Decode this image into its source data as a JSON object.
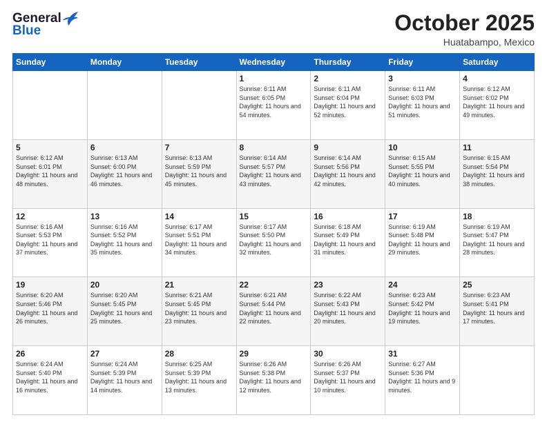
{
  "header": {
    "logo_general": "General",
    "logo_blue": "Blue",
    "month": "October 2025",
    "location": "Huatabampo, Mexico"
  },
  "weekdays": [
    "Sunday",
    "Monday",
    "Tuesday",
    "Wednesday",
    "Thursday",
    "Friday",
    "Saturday"
  ],
  "weeks": [
    [
      {
        "day": "",
        "sunrise": "",
        "sunset": "",
        "daylight": ""
      },
      {
        "day": "",
        "sunrise": "",
        "sunset": "",
        "daylight": ""
      },
      {
        "day": "",
        "sunrise": "",
        "sunset": "",
        "daylight": ""
      },
      {
        "day": "1",
        "sunrise": "Sunrise: 6:11 AM",
        "sunset": "Sunset: 6:05 PM",
        "daylight": "Daylight: 11 hours and 54 minutes."
      },
      {
        "day": "2",
        "sunrise": "Sunrise: 6:11 AM",
        "sunset": "Sunset: 6:04 PM",
        "daylight": "Daylight: 11 hours and 52 minutes."
      },
      {
        "day": "3",
        "sunrise": "Sunrise: 6:11 AM",
        "sunset": "Sunset: 6:03 PM",
        "daylight": "Daylight: 11 hours and 51 minutes."
      },
      {
        "day": "4",
        "sunrise": "Sunrise: 6:12 AM",
        "sunset": "Sunset: 6:02 PM",
        "daylight": "Daylight: 11 hours and 49 minutes."
      }
    ],
    [
      {
        "day": "5",
        "sunrise": "Sunrise: 6:12 AM",
        "sunset": "Sunset: 6:01 PM",
        "daylight": "Daylight: 11 hours and 48 minutes."
      },
      {
        "day": "6",
        "sunrise": "Sunrise: 6:13 AM",
        "sunset": "Sunset: 6:00 PM",
        "daylight": "Daylight: 11 hours and 46 minutes."
      },
      {
        "day": "7",
        "sunrise": "Sunrise: 6:13 AM",
        "sunset": "Sunset: 5:59 PM",
        "daylight": "Daylight: 11 hours and 45 minutes."
      },
      {
        "day": "8",
        "sunrise": "Sunrise: 6:14 AM",
        "sunset": "Sunset: 5:57 PM",
        "daylight": "Daylight: 11 hours and 43 minutes."
      },
      {
        "day": "9",
        "sunrise": "Sunrise: 6:14 AM",
        "sunset": "Sunset: 5:56 PM",
        "daylight": "Daylight: 11 hours and 42 minutes."
      },
      {
        "day": "10",
        "sunrise": "Sunrise: 6:15 AM",
        "sunset": "Sunset: 5:55 PM",
        "daylight": "Daylight: 11 hours and 40 minutes."
      },
      {
        "day": "11",
        "sunrise": "Sunrise: 6:15 AM",
        "sunset": "Sunset: 5:54 PM",
        "daylight": "Daylight: 11 hours and 38 minutes."
      }
    ],
    [
      {
        "day": "12",
        "sunrise": "Sunrise: 6:16 AM",
        "sunset": "Sunset: 5:53 PM",
        "daylight": "Daylight: 11 hours and 37 minutes."
      },
      {
        "day": "13",
        "sunrise": "Sunrise: 6:16 AM",
        "sunset": "Sunset: 5:52 PM",
        "daylight": "Daylight: 11 hours and 35 minutes."
      },
      {
        "day": "14",
        "sunrise": "Sunrise: 6:17 AM",
        "sunset": "Sunset: 5:51 PM",
        "daylight": "Daylight: 11 hours and 34 minutes."
      },
      {
        "day": "15",
        "sunrise": "Sunrise: 6:17 AM",
        "sunset": "Sunset: 5:50 PM",
        "daylight": "Daylight: 11 hours and 32 minutes."
      },
      {
        "day": "16",
        "sunrise": "Sunrise: 6:18 AM",
        "sunset": "Sunset: 5:49 PM",
        "daylight": "Daylight: 11 hours and 31 minutes."
      },
      {
        "day": "17",
        "sunrise": "Sunrise: 6:19 AM",
        "sunset": "Sunset: 5:48 PM",
        "daylight": "Daylight: 11 hours and 29 minutes."
      },
      {
        "day": "18",
        "sunrise": "Sunrise: 6:19 AM",
        "sunset": "Sunset: 5:47 PM",
        "daylight": "Daylight: 11 hours and 28 minutes."
      }
    ],
    [
      {
        "day": "19",
        "sunrise": "Sunrise: 6:20 AM",
        "sunset": "Sunset: 5:46 PM",
        "daylight": "Daylight: 11 hours and 26 minutes."
      },
      {
        "day": "20",
        "sunrise": "Sunrise: 6:20 AM",
        "sunset": "Sunset: 5:45 PM",
        "daylight": "Daylight: 11 hours and 25 minutes."
      },
      {
        "day": "21",
        "sunrise": "Sunrise: 6:21 AM",
        "sunset": "Sunset: 5:45 PM",
        "daylight": "Daylight: 11 hours and 23 minutes."
      },
      {
        "day": "22",
        "sunrise": "Sunrise: 6:21 AM",
        "sunset": "Sunset: 5:44 PM",
        "daylight": "Daylight: 11 hours and 22 minutes."
      },
      {
        "day": "23",
        "sunrise": "Sunrise: 6:22 AM",
        "sunset": "Sunset: 5:43 PM",
        "daylight": "Daylight: 11 hours and 20 minutes."
      },
      {
        "day": "24",
        "sunrise": "Sunrise: 6:23 AM",
        "sunset": "Sunset: 5:42 PM",
        "daylight": "Daylight: 11 hours and 19 minutes."
      },
      {
        "day": "25",
        "sunrise": "Sunrise: 6:23 AM",
        "sunset": "Sunset: 5:41 PM",
        "daylight": "Daylight: 11 hours and 17 minutes."
      }
    ],
    [
      {
        "day": "26",
        "sunrise": "Sunrise: 6:24 AM",
        "sunset": "Sunset: 5:40 PM",
        "daylight": "Daylight: 11 hours and 16 minutes."
      },
      {
        "day": "27",
        "sunrise": "Sunrise: 6:24 AM",
        "sunset": "Sunset: 5:39 PM",
        "daylight": "Daylight: 11 hours and 14 minutes."
      },
      {
        "day": "28",
        "sunrise": "Sunrise: 6:25 AM",
        "sunset": "Sunset: 5:39 PM",
        "daylight": "Daylight: 11 hours and 13 minutes."
      },
      {
        "day": "29",
        "sunrise": "Sunrise: 6:26 AM",
        "sunset": "Sunset: 5:38 PM",
        "daylight": "Daylight: 11 hours and 12 minutes."
      },
      {
        "day": "30",
        "sunrise": "Sunrise: 6:26 AM",
        "sunset": "Sunset: 5:37 PM",
        "daylight": "Daylight: 11 hours and 10 minutes."
      },
      {
        "day": "31",
        "sunrise": "Sunrise: 6:27 AM",
        "sunset": "Sunset: 5:36 PM",
        "daylight": "Daylight: 11 hours and 9 minutes."
      },
      {
        "day": "",
        "sunrise": "",
        "sunset": "",
        "daylight": ""
      }
    ]
  ]
}
